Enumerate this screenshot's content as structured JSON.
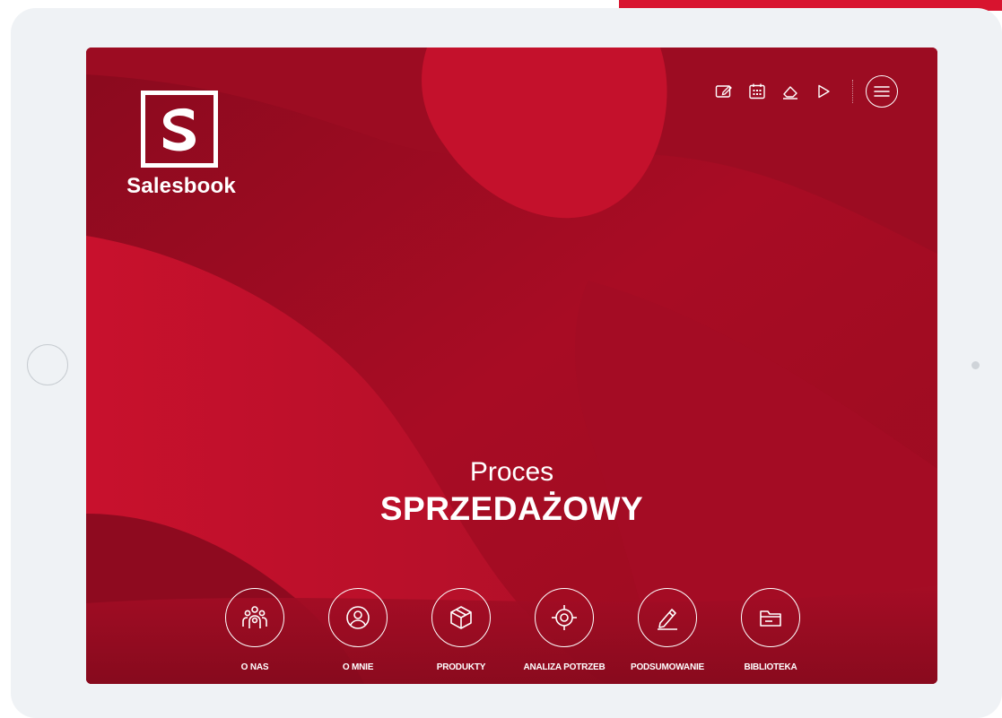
{
  "brand": {
    "name": "Salesbook",
    "accent_color": "#d8142f",
    "background_color": "#b8102a"
  },
  "toolbar": {
    "icons": [
      "notes-icon",
      "calendar-icon",
      "eraser-icon",
      "play-icon"
    ],
    "menu_icon": "menu-icon"
  },
  "hero": {
    "line1": "Proces",
    "line2": "SPRZEDAŻOWY"
  },
  "nav": {
    "items": [
      {
        "label": "O NAS",
        "icon": "group-icon"
      },
      {
        "label": "O MNIE",
        "icon": "user-icon"
      },
      {
        "label": "PRODUKTY",
        "icon": "box-icon"
      },
      {
        "label": "ANALIZA POTRZEB",
        "icon": "target-icon"
      },
      {
        "label": "PODSUMOWANIE",
        "icon": "pencil-icon"
      },
      {
        "label": "BIBLIOTEKA",
        "icon": "folder-icon"
      }
    ]
  }
}
